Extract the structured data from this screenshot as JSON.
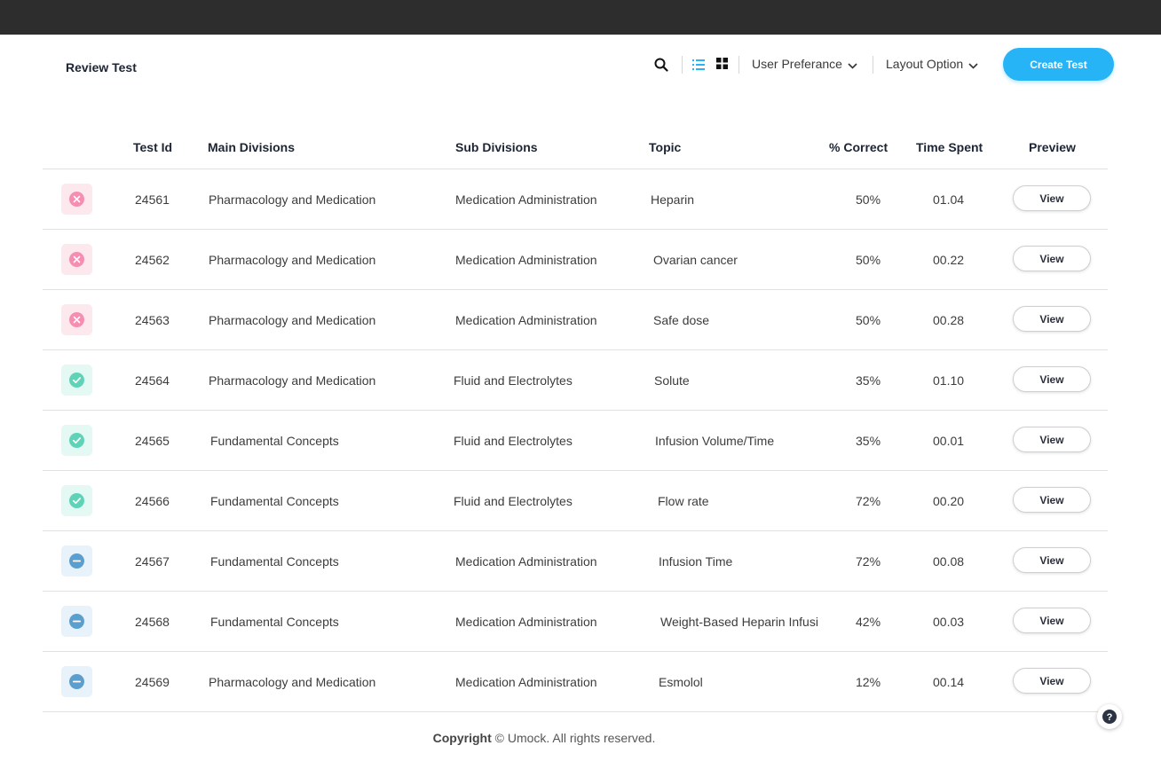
{
  "page": {
    "title": "Review Test"
  },
  "toolbar": {
    "user_preference": "User Preferance",
    "layout_option": "Layout Option",
    "create_test": "Create Test",
    "icons": [
      "search-icon",
      "list-view-icon",
      "grid-view-icon",
      "chevron-down-icon"
    ]
  },
  "table": {
    "headers": {
      "test_id": "Test Id",
      "main_divisions": "Main Divisions",
      "sub_divisions": "Sub Divisions",
      "topic": "Topic",
      "correct": "% Correct",
      "time_spent": "Time Spent",
      "preview": "Preview"
    },
    "rows": [
      {
        "status": "incorrect",
        "id": "24561",
        "main": "Pharmacology and Medication",
        "sub": "Medication Administration",
        "topic": "Heparin",
        "correct": "50%",
        "time": "01.04",
        "action": "View"
      },
      {
        "status": "incorrect",
        "id": "24562",
        "main": "Pharmacology and Medication",
        "sub": "Medication Administration",
        "topic": "Ovarian cancer",
        "correct": "50%",
        "time": "00.22",
        "action": "View"
      },
      {
        "status": "incorrect",
        "id": "24563",
        "main": "Pharmacology and Medication",
        "sub": "Medication Administration",
        "topic": "Safe dose",
        "correct": "50%",
        "time": "00.28",
        "action": "View"
      },
      {
        "status": "correct",
        "id": "24564",
        "main": "Pharmacology and Medication",
        "sub": "Fluid and Electrolytes",
        "topic": "Solute",
        "correct": "35%",
        "time": "01.10",
        "action": "View"
      },
      {
        "status": "correct",
        "id": "24565",
        "main": "Fundamental Concepts",
        "sub": "Fluid and Electrolytes",
        "topic": "Infusion Volume/Time",
        "correct": "35%",
        "time": "00.01",
        "action": "View"
      },
      {
        "status": "correct",
        "id": "24566",
        "main": "Fundamental Concepts",
        "sub": "Fluid and Electrolytes",
        "topic": "Flow rate",
        "correct": "72%",
        "time": "00.20",
        "action": "View"
      },
      {
        "status": "unanswered",
        "id": "24567",
        "main": "Fundamental Concepts",
        "sub": "Medication Administration",
        "topic": "Infusion Time",
        "correct": "72%",
        "time": "00.08",
        "action": "View"
      },
      {
        "status": "unanswered",
        "id": "24568",
        "main": "Fundamental Concepts",
        "sub": "Medication Administration",
        "topic": "Weight-Based Heparin Infusi",
        "correct": "42%",
        "time": "00.03",
        "action": "View"
      },
      {
        "status": "unanswered",
        "id": "24569",
        "main": "Pharmacology and Medication",
        "sub": "Medication Administration",
        "topic": "Esmolol",
        "correct": "12%",
        "time": "00.14",
        "action": "View"
      }
    ]
  },
  "status_colors": {
    "incorrect": {
      "bg": "#fde8ee",
      "icon": "#f48fb1"
    },
    "correct": {
      "bg": "#e4f8f4",
      "icon": "#5fd3b8"
    },
    "unanswered": {
      "bg": "#e8f2fa",
      "icon": "#5b9fcf"
    }
  },
  "footer": {
    "copyright_label": "Copyright",
    "text": "© Umock. All rights reserved."
  },
  "help": {
    "icon": "help-icon"
  },
  "accent_color": "#26b4f6"
}
